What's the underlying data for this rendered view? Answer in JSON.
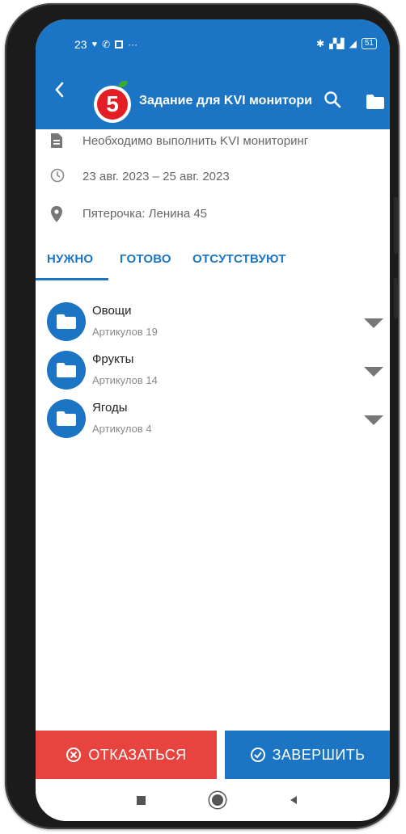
{
  "status": {
    "time": "23",
    "battery": "51"
  },
  "appbar": {
    "title": "Задание для KVI монитори",
    "logo_text": "5"
  },
  "info": {
    "description": "Необходимо выполнить KVI мониторинг",
    "dates": "23 авг. 2023 – 25 авг. 2023",
    "store": "Пятерочка: Ленина 45"
  },
  "tabs": [
    {
      "label": "НУЖНО"
    },
    {
      "label": "ГОТОВО"
    },
    {
      "label": "ОТСУТСТВУЮТ"
    }
  ],
  "categories": [
    {
      "name": "Овощи",
      "count": "Артикулов 19"
    },
    {
      "name": "Фрукты",
      "count": "Артикулов 14"
    },
    {
      "name": "Ягоды",
      "count": "Артикулов 4"
    }
  ],
  "buttons": {
    "cancel": "ОТКАЗАТЬСЯ",
    "finish": "ЗАВЕРШИТЬ"
  },
  "colors": {
    "primary": "#1b74c4",
    "danger": "#e8443f",
    "brand_red": "#e31e24"
  }
}
